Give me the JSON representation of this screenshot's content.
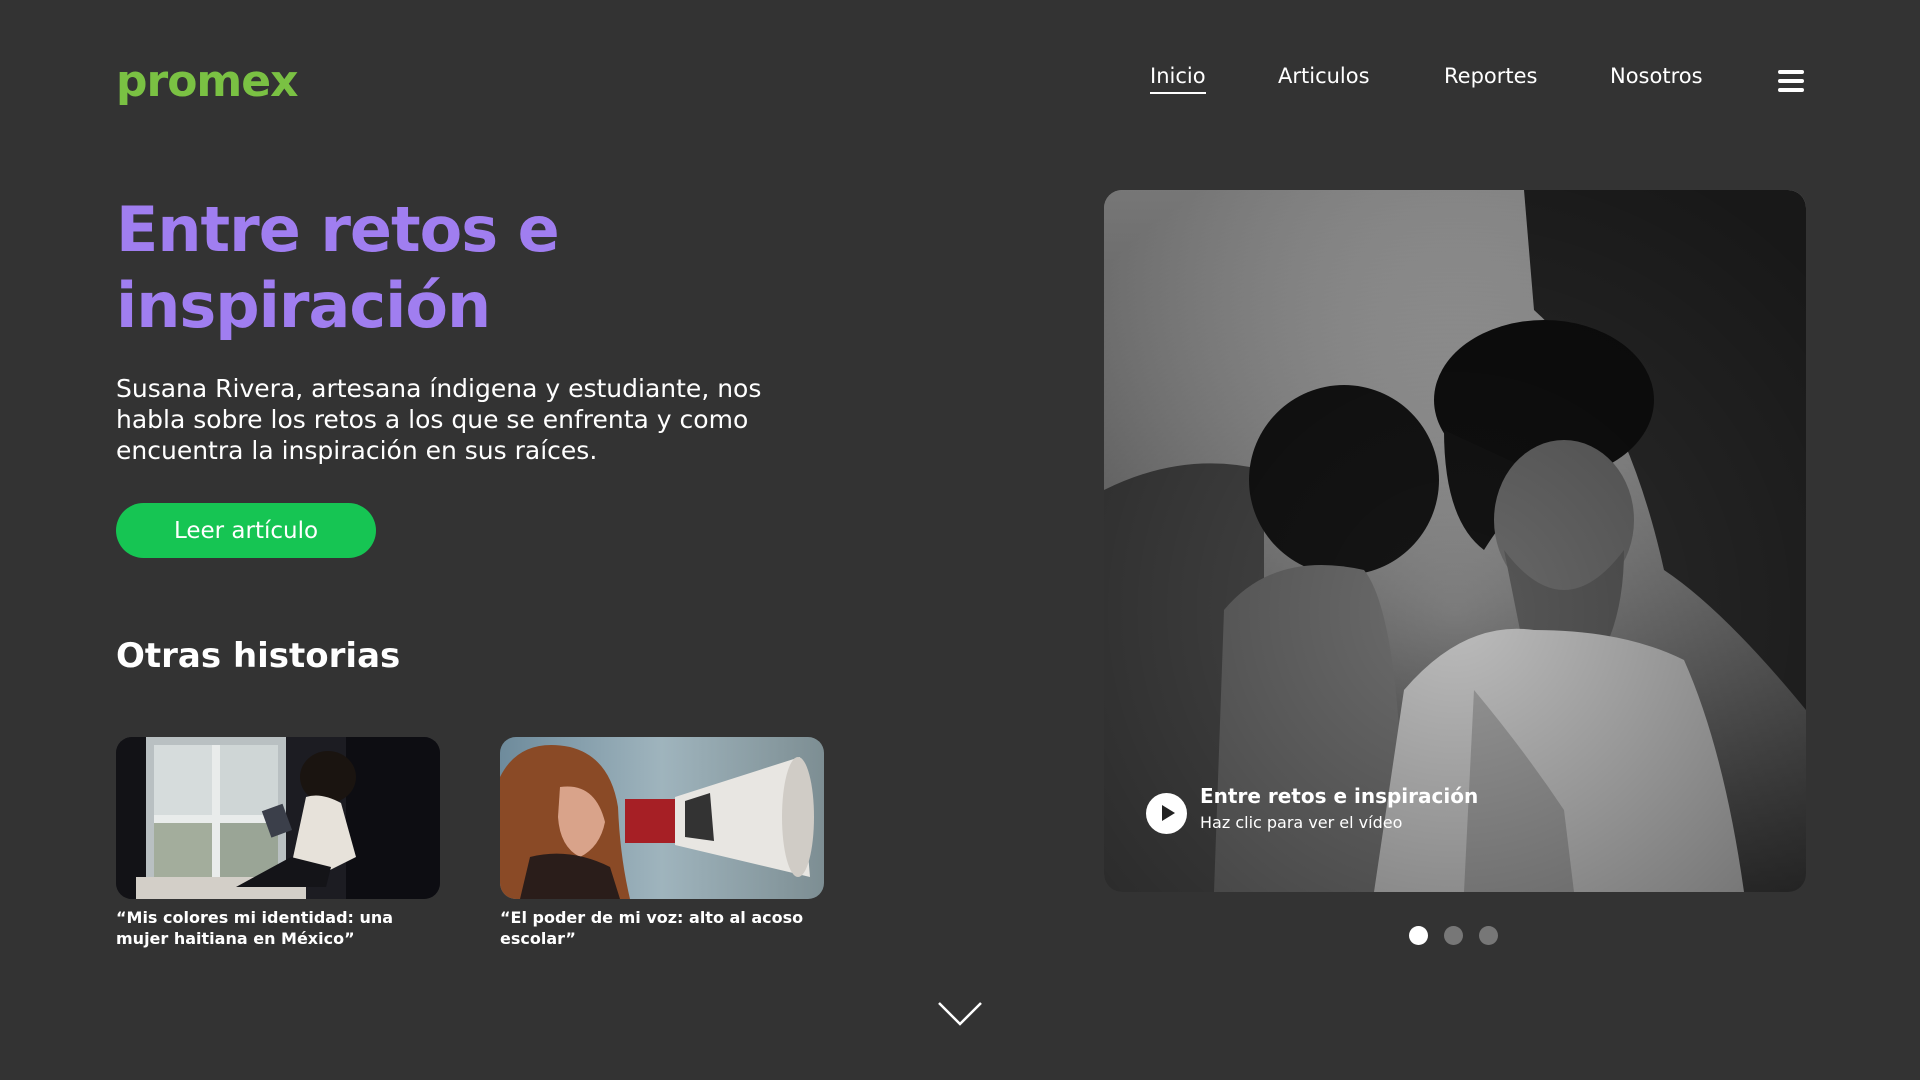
{
  "brand": {
    "logo": "promex",
    "logo_color": "#7ac143"
  },
  "nav": {
    "items": [
      {
        "label": "Inicio",
        "active": true
      },
      {
        "label": "Articulos",
        "active": false
      },
      {
        "label": "Reportes",
        "active": false
      },
      {
        "label": "Nosotros",
        "active": false
      }
    ],
    "menu_icon": "hamburger-menu-icon"
  },
  "hero": {
    "title": "Entre retos e inspiración",
    "title_color": "#a07ef0",
    "description": "Susana Rivera, artesana índigena y estudiante, nos habla sobre los retos a los que se enfrenta y como encuentra la inspiración en sus raíces.",
    "cta_label": "Leer artículo",
    "cta_color": "#16c553"
  },
  "stories": {
    "heading": "Otras historias",
    "items": [
      {
        "caption": "“Mis colores mi identidad: una mujer haitiana en México”",
        "image": "woman-reading-by-window"
      },
      {
        "caption": "“El poder de mi voz: alto al acoso escolar”",
        "image": "woman-with-megaphone"
      }
    ]
  },
  "video": {
    "title": "Entre retos e inspiración",
    "subtitle": "Haz clic para ver el vídeo",
    "image": "indigenous-woman-smiling-bw",
    "play_icon": "play-icon"
  },
  "carousel": {
    "count": 3,
    "active_index": 0
  },
  "scroll_icon": "chevron-down-icon"
}
